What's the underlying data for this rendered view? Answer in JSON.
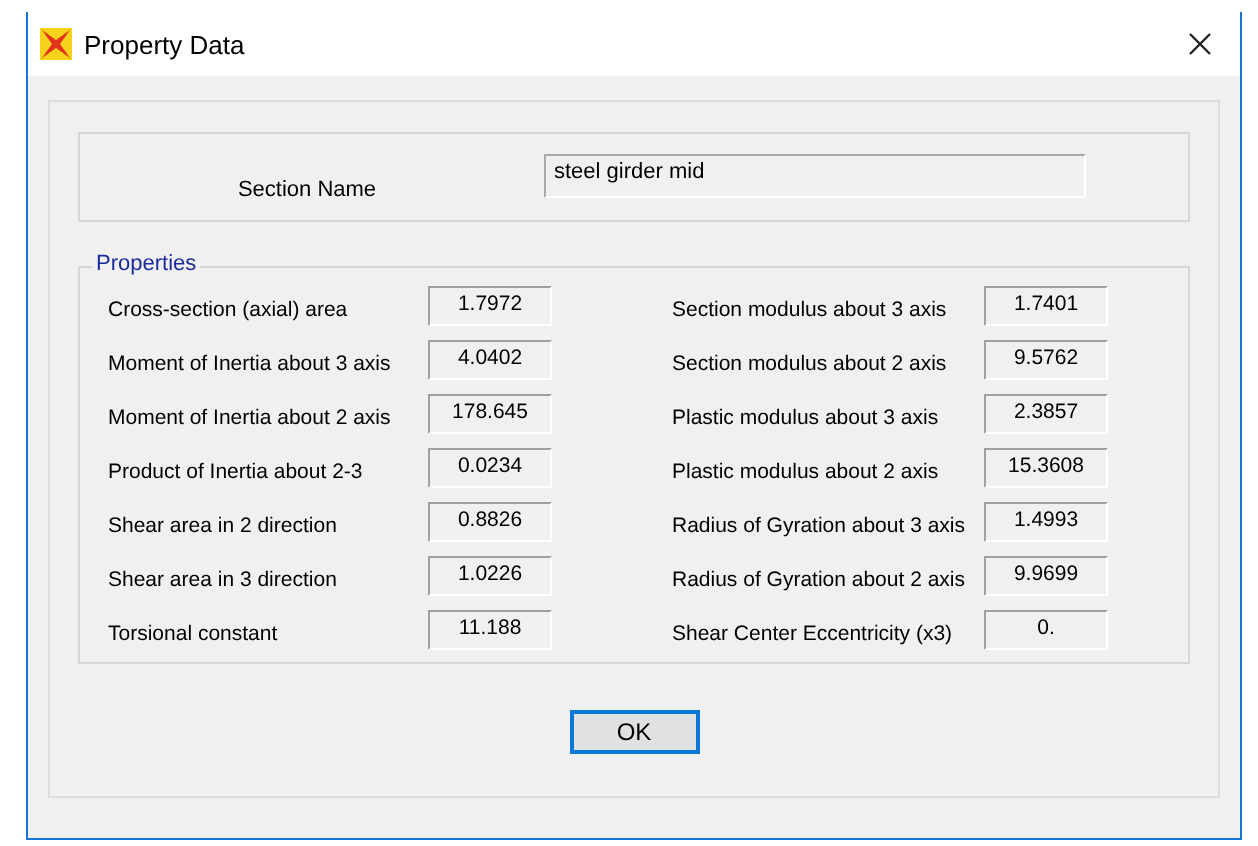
{
  "window": {
    "title": "Property Data"
  },
  "section_name": {
    "label": "Section Name",
    "value": "steel girder mid"
  },
  "properties": {
    "title": "Properties",
    "left": [
      {
        "label": "Cross-section (axial) area",
        "value": "1.7972"
      },
      {
        "label": "Moment of Inertia about 3 axis",
        "value": "4.0402"
      },
      {
        "label": "Moment of Inertia about 2 axis",
        "value": "178.645"
      },
      {
        "label": "Product of Inertia about 2-3",
        "value": "0.0234"
      },
      {
        "label": "Shear area in 2 direction",
        "value": "0.8826"
      },
      {
        "label": "Shear area in 3 direction",
        "value": "1.0226"
      },
      {
        "label": "Torsional constant",
        "value": "11.188"
      }
    ],
    "right": [
      {
        "label": "Section modulus about 3 axis",
        "value": "1.7401"
      },
      {
        "label": "Section modulus about 2 axis",
        "value": "9.5762"
      },
      {
        "label": "Plastic modulus about 3 axis",
        "value": "2.3857"
      },
      {
        "label": "Plastic modulus about 2 axis",
        "value": "15.3608"
      },
      {
        "label": "Radius of Gyration about 3 axis",
        "value": "1.4993"
      },
      {
        "label": "Radius of Gyration about 2 axis",
        "value": "9.9699"
      },
      {
        "label": "Shear Center Eccentricity (x3)",
        "value": "0."
      }
    ]
  },
  "buttons": [
    "OK"
  ]
}
